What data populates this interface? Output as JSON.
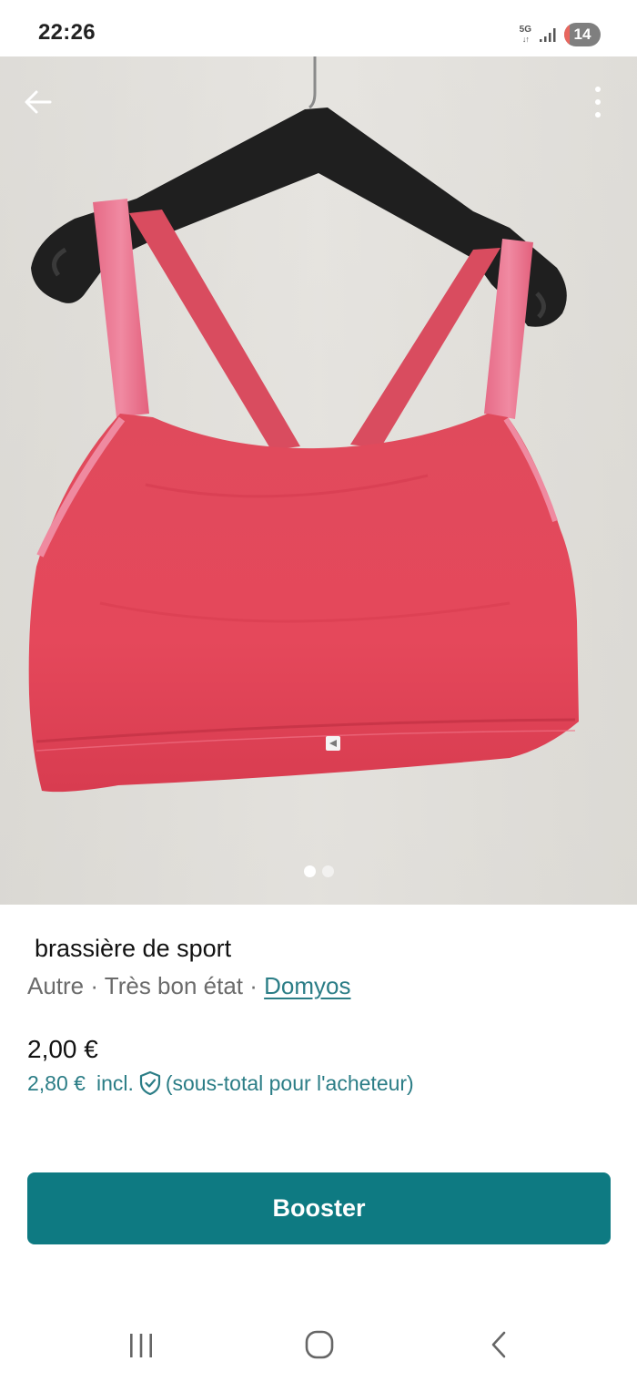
{
  "status_bar": {
    "time": "22:26",
    "network": "5G",
    "network_arrows": "↓↑",
    "battery": "14",
    "battery_level": 0.14
  },
  "gallery": {
    "image_count": 2,
    "active_index": 0
  },
  "listing": {
    "title": "brassière de sport",
    "category": "Autre",
    "separator": " · ",
    "condition": "Très bon état",
    "brand": "Domyos",
    "price": "2,00 €",
    "buyer_price": "2,80 €",
    "incl_label": "incl.",
    "buyer_note": "(sous-total pour l'acheteur)"
  },
  "actions": {
    "booster_label": "Booster"
  },
  "colors": {
    "accent": "#0e7a82",
    "link": "#2b7d86",
    "muted_text": "#6b6b6b",
    "battery_low": "#e8675f"
  }
}
